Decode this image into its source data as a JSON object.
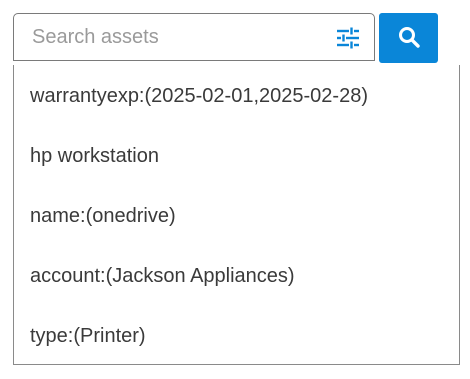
{
  "search": {
    "placeholder": "Search assets",
    "value": "",
    "filter_icon": "sliders-icon",
    "button_icon": "magnifier-icon"
  },
  "colors": {
    "accent": "#0a86d8",
    "border": "#7a7a7a",
    "text": "#3a3a3a",
    "placeholder": "#9a9a9a"
  },
  "suggestions": [
    {
      "label": "warrantyexp:(2025-02-01,2025-02-28)"
    },
    {
      "label": "hp workstation"
    },
    {
      "label": "name:(onedrive)"
    },
    {
      "label": "account:(Jackson Appliances)"
    },
    {
      "label": "type:(Printer)"
    }
  ]
}
